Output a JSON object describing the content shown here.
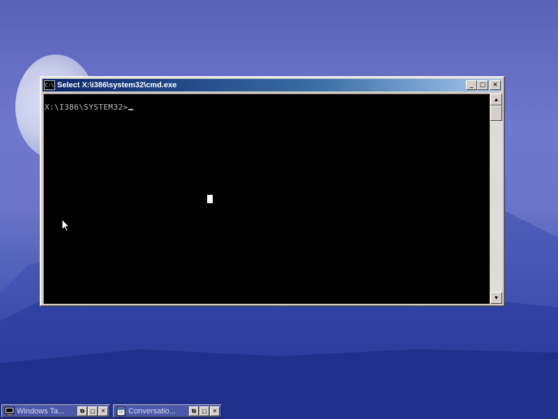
{
  "window": {
    "title": "Select X:\\i386\\system32\\cmd.exe",
    "icon_text": "C:\\",
    "icon": "cmd-icon",
    "buttons": {
      "minimize": "_",
      "restore": "□",
      "close": "✕"
    }
  },
  "console": {
    "prompt": "X:\\I386\\SYSTEM32>",
    "text_color": "#c0c0c0",
    "background": "#000000"
  },
  "scrollbar": {
    "up_arrow": "▲",
    "down_arrow": "▼"
  },
  "taskbar": {
    "items": [
      {
        "label": "Windows Ta...",
        "icon": "computer-icon"
      },
      {
        "label": "Conversatio...",
        "icon": "document-icon"
      }
    ],
    "buttons": {
      "restore": "⧉",
      "maximize": "□",
      "close": "✕"
    }
  },
  "colors": {
    "titlebar_start": "#0a246a",
    "titlebar_end": "#a6caf0",
    "window_face": "#d4d0c8"
  }
}
